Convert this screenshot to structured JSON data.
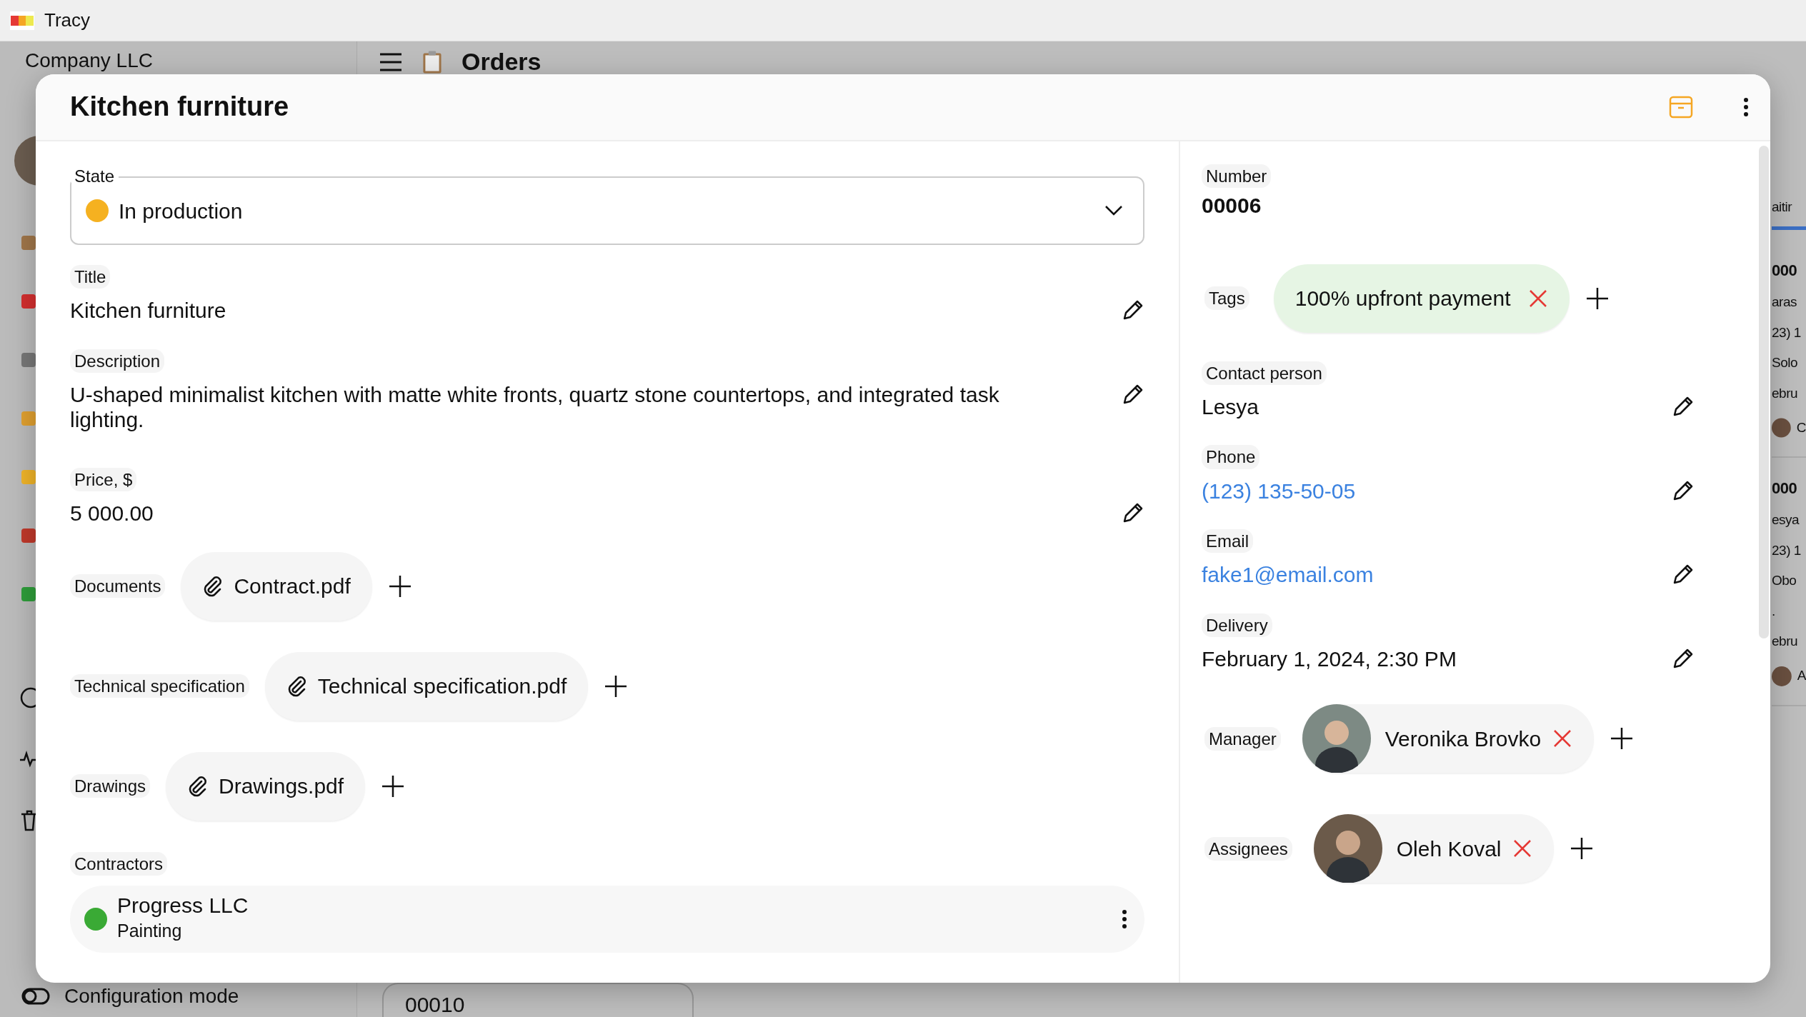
{
  "window": {
    "title": "Tracy"
  },
  "background": {
    "company": "Company LLC",
    "page_title": "Orders",
    "footer": "Configuration mode",
    "tab_fragment": "aitir",
    "bottom_card": "00010",
    "cards": [
      {
        "lines": [
          "000",
          "aras",
          "23) 1",
          "Solo",
          "ebru"
        ],
        "person": "C"
      },
      {
        "lines": [
          "000",
          "esya",
          "23) 1",
          "Obo",
          ".",
          "ebru"
        ],
        "person": "A"
      }
    ]
  },
  "modal": {
    "title": "Kitchen furniture",
    "state": {
      "label": "State",
      "value": "In production",
      "color": "#f5b120"
    },
    "left_fields": [
      {
        "label": "Title",
        "value": "Kitchen furniture"
      },
      {
        "label": "Description",
        "value": "U-shaped minimalist kitchen with matte white fronts, quartz stone countertops, and integrated task lighting."
      },
      {
        "label": "Price, $",
        "value": "5 000.00"
      }
    ],
    "attachments": [
      {
        "label": "Documents",
        "file": "Contract.pdf"
      },
      {
        "label": "Technical specification",
        "file": "Technical specification.pdf"
      },
      {
        "label": "Drawings",
        "file": "Drawings.pdf"
      }
    ],
    "contractors": {
      "label": "Contractors",
      "items": [
        {
          "name": "Progress LLC",
          "role": "Painting",
          "color": "#3aaa35"
        }
      ]
    },
    "number": {
      "label": "Number",
      "value": "00006"
    },
    "tags": {
      "label": "Tags",
      "items": [
        {
          "text": "100% upfront payment"
        }
      ]
    },
    "right_fields": [
      {
        "label": "Contact person",
        "value": "Lesya",
        "kind": "text"
      },
      {
        "label": "Phone",
        "value": "(123) 135-50-05",
        "kind": "link"
      },
      {
        "label": "Email",
        "value": "fake1@email.com",
        "kind": "link"
      },
      {
        "label": "Delivery",
        "value": "February 1, 2024, 2:30 PM",
        "kind": "text"
      }
    ],
    "people": [
      {
        "label": "Manager",
        "items": [
          {
            "name": "Veronika Brovko"
          }
        ]
      },
      {
        "label": "Assignees",
        "items": [
          {
            "name": "Oleh Koval"
          }
        ]
      }
    ]
  }
}
